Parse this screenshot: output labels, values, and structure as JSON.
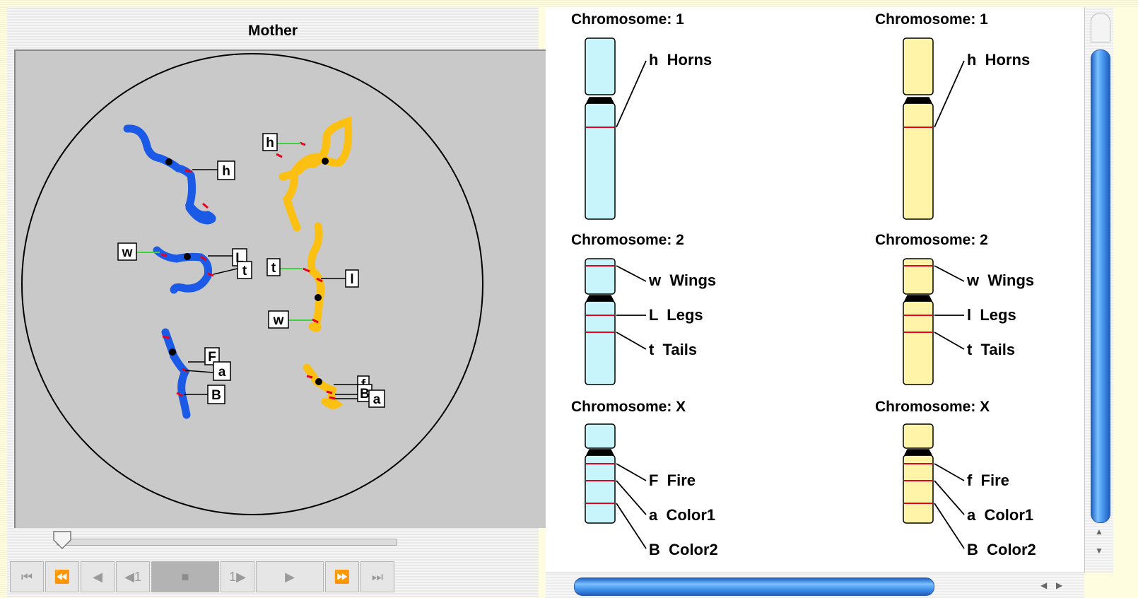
{
  "mother_panel": {
    "title": "Mother",
    "cell_gene_tags": [
      "h",
      "h",
      "w",
      "L",
      "t",
      "t",
      "l",
      "w",
      "F",
      "a",
      "B",
      "f",
      "B",
      "a"
    ]
  },
  "playback_controls": {
    "buttons": [
      {
        "name": "skip-to-start",
        "glyph": "⏮"
      },
      {
        "name": "rewind",
        "glyph": "⏪"
      },
      {
        "name": "step-back",
        "glyph": "◀"
      },
      {
        "name": "back-one",
        "glyph": "◀1"
      },
      {
        "name": "stop",
        "glyph": "■"
      },
      {
        "name": "forward-one",
        "glyph": "1▶"
      },
      {
        "name": "play",
        "glyph": "▶"
      },
      {
        "name": "fast-forward",
        "glyph": "⏩"
      },
      {
        "name": "skip-to-end",
        "glyph": "⏭"
      }
    ],
    "slider_value": 0
  },
  "chromosomes": {
    "left": [
      {
        "title": "Chromosome: 1",
        "genes": [
          "h  Horns"
        ]
      },
      {
        "title": "Chromosome: 2",
        "genes": [
          "w  Wings",
          "L  Legs",
          "t  Tails"
        ]
      },
      {
        "title": "Chromosome: X",
        "genes": [
          "F  Fire",
          "a  Color1",
          "B  Color2"
        ]
      }
    ],
    "right": [
      {
        "title": "Chromosome: 1",
        "genes": [
          "h  Horns"
        ]
      },
      {
        "title": "Chromosome: 2",
        "genes": [
          "w  Wings",
          "l  Legs",
          "t  Tails"
        ]
      },
      {
        "title": "Chromosome: X",
        "genes": [
          "f  Fire",
          "a  Color1",
          "B  Color2"
        ]
      }
    ]
  },
  "colors": {
    "left_chromosome_fill": "#c8f4fb",
    "right_chromosome_fill": "#fff4a8",
    "mother_strand_blue": "#1b5ae6",
    "mother_strand_yellow": "#fcc012",
    "gene_marker": "#e8001c"
  }
}
